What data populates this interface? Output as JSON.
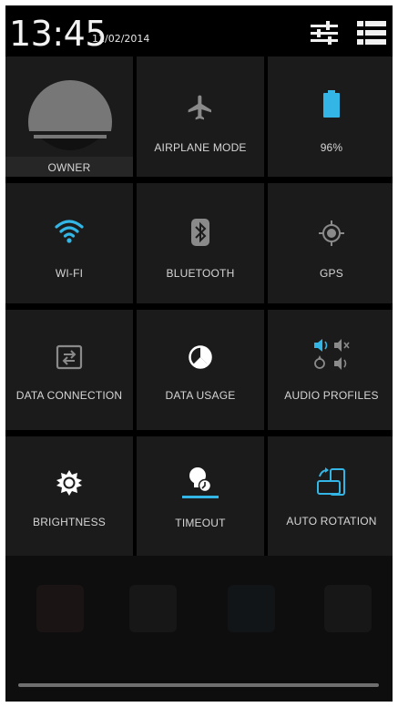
{
  "status_bar": {
    "time": "13:45",
    "date": "11/02/2014",
    "settings_icon": "sliders-icon",
    "list_icon": "list-icon"
  },
  "tiles": {
    "owner": {
      "label": "OWNER",
      "icon": "avatar"
    },
    "airplane": {
      "label": "AIRPLANE MODE",
      "icon": "airplane-icon"
    },
    "battery": {
      "label": "96%",
      "icon": "battery-icon",
      "level": 0.96
    },
    "wifi": {
      "label": "WI-FI",
      "icon": "wifi-icon"
    },
    "bluetooth": {
      "label": "BLUETOOTH",
      "icon": "bluetooth-icon"
    },
    "gps": {
      "label": "GPS",
      "icon": "gps-icon"
    },
    "data_connection": {
      "label": "DATA CONNECTION",
      "icon": "data-connection-icon"
    },
    "data_usage": {
      "label": "DATA USAGE",
      "icon": "data-usage-icon"
    },
    "audio_profiles": {
      "label": "AUDIO PROFILES",
      "icon": "audio-profiles-icon"
    },
    "brightness": {
      "label": "BRIGHTNESS",
      "icon": "sun-icon"
    },
    "timeout": {
      "label": "TIMEOUT",
      "icon": "timeout-icon"
    },
    "auto_rotation": {
      "label": "AUTO ROTATION",
      "icon": "rotation-icon"
    }
  },
  "colors": {
    "accent": "#33b5e5",
    "tile_bg": "#1b1b1b",
    "inactive_icon": "#8a8a8a",
    "active_icon": "#ffffff"
  }
}
